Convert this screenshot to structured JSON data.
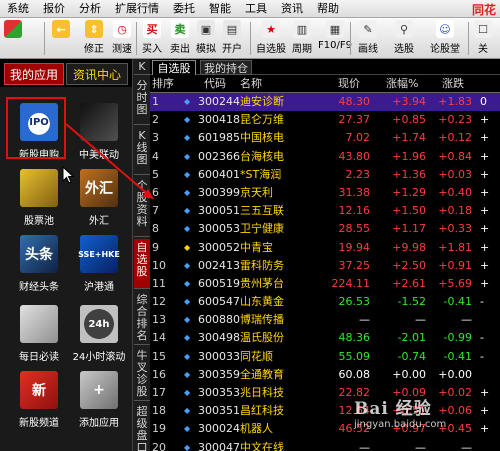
{
  "menubar": {
    "items": [
      "系统",
      "报价",
      "分析",
      "扩展行情",
      "委托",
      "智能",
      "工具",
      "资讯",
      "帮助"
    ],
    "brand": "同花"
  },
  "toolbar": {
    "buttons": [
      {
        "label": "",
        "icon": "color-grid-icon"
      },
      {
        "label": "",
        "icon": "back-arrow-icon"
      },
      {
        "label": "修正",
        "icon": "up-down-arrow-icon"
      },
      {
        "label": "测速",
        "icon": "clock-icon"
      },
      {
        "label": "买入",
        "icon": "buy-icon",
        "glyph": "买"
      },
      {
        "label": "卖出",
        "icon": "sell-icon",
        "glyph": "卖"
      },
      {
        "label": "模拟",
        "icon": "simulate-icon"
      },
      {
        "label": "开户",
        "icon": "open-account-icon"
      },
      {
        "label": "自选股",
        "icon": "watchlist-icon"
      },
      {
        "label": "周期",
        "icon": "period-icon"
      },
      {
        "label": "F10/F9",
        "icon": "f10-icon"
      },
      {
        "label": "画线",
        "icon": "draw-line-icon"
      },
      {
        "label": "选股",
        "icon": "stock-picker-icon"
      },
      {
        "label": "论股堂",
        "icon": "forum-icon"
      },
      {
        "label": "关",
        "icon": "close-icon"
      }
    ]
  },
  "left_panel": {
    "tabs": [
      "我的应用",
      "资讯中心"
    ],
    "apps": [
      {
        "label": "新股申购",
        "icon": "ipo-gauge-icon",
        "glyph": "IPO"
      },
      {
        "label": "中美联动",
        "icon": "us-china-chart-icon",
        "glyph": ""
      },
      {
        "label": "股票池",
        "icon": "stock-pool-icon",
        "glyph": ""
      },
      {
        "label": "外汇",
        "icon": "forex-icon",
        "glyph": "外汇"
      },
      {
        "label": "财经头条",
        "icon": "news-headline-icon",
        "glyph": "头条"
      },
      {
        "label": "沪港通",
        "icon": "hk-connect-icon",
        "glyph": "SSE+HKE"
      },
      {
        "label": "每日必读",
        "icon": "daily-read-icon",
        "glyph": ""
      },
      {
        "label": "24小时滚动",
        "icon": "clock-24h-icon",
        "glyph": "24h"
      },
      {
        "label": "新股频道",
        "icon": "new-stock-channel-icon",
        "glyph": "新"
      },
      {
        "label": "添加应用",
        "icon": "add-icon",
        "glyph": "+"
      }
    ]
  },
  "vertical_tabs": [
    "分时图",
    "K线图",
    "个股资料",
    "自选股",
    "综合排名",
    "牛叉诊股",
    "超级盘口"
  ],
  "vtab_collapse": "K",
  "main": {
    "tabs": [
      "自选股",
      "我的持仓"
    ],
    "columns": {
      "idx": "排序",
      "code": "代码",
      "name": "名称",
      "price": "现价",
      "pct": "涨幅%",
      "chg": "涨跌"
    },
    "rows": [
      {
        "idx": "1",
        "code": "300244",
        "name": "迪安诊断",
        "price": "48.30",
        "pct": "+3.94",
        "chg": "+1.83",
        "extra": "0",
        "dir": "up",
        "sel": true
      },
      {
        "idx": "2",
        "code": "300418",
        "name": "昆仑万维",
        "price": "27.37",
        "pct": "+0.85",
        "chg": "+0.23",
        "extra": "+",
        "dir": "up"
      },
      {
        "idx": "3",
        "code": "601985",
        "name": "中国核电",
        "price": "7.02",
        "pct": "+1.74",
        "chg": "+0.12",
        "extra": "+",
        "dir": "up"
      },
      {
        "idx": "4",
        "code": "002366",
        "name": "台海核电",
        "price": "43.80",
        "pct": "+1.96",
        "chg": "+0.84",
        "extra": "+",
        "dir": "up"
      },
      {
        "idx": "5",
        "code": "600401",
        "name": "*ST海润",
        "price": "2.23",
        "pct": "+1.36",
        "chg": "+0.03",
        "extra": "+",
        "dir": "up"
      },
      {
        "idx": "6",
        "code": "300399",
        "name": "京天利",
        "price": "31.38",
        "pct": "+1.29",
        "chg": "+0.40",
        "extra": "+",
        "dir": "up"
      },
      {
        "idx": "7",
        "code": "300051",
        "name": "三五互联",
        "price": "12.16",
        "pct": "+1.50",
        "chg": "+0.18",
        "extra": "+",
        "dir": "up"
      },
      {
        "idx": "8",
        "code": "300053",
        "name": "卫宁健康",
        "price": "28.55",
        "pct": "+1.17",
        "chg": "+0.33",
        "extra": "+",
        "dir": "up"
      },
      {
        "idx": "9",
        "code": "300052",
        "name": "中青宝",
        "price": "19.94",
        "pct": "+9.98",
        "chg": "+1.81",
        "extra": "+",
        "dir": "up"
      },
      {
        "idx": "10",
        "code": "002413",
        "name": "雷科防务",
        "price": "37.25",
        "pct": "+2.50",
        "chg": "+0.91",
        "extra": "+",
        "dir": "up"
      },
      {
        "idx": "11",
        "code": "600519",
        "name": "贵州茅台",
        "price": "224.11",
        "pct": "+2.61",
        "chg": "+5.69",
        "extra": "+",
        "dir": "up"
      },
      {
        "idx": "12",
        "code": "600547",
        "name": "山东黄金",
        "price": "26.53",
        "pct": "-1.52",
        "chg": "-0.41",
        "extra": "-",
        "dir": "down"
      },
      {
        "idx": "13",
        "code": "600880",
        "name": "博瑞传播",
        "price": "—",
        "pct": "—",
        "chg": "—",
        "extra": "",
        "dir": "flat"
      },
      {
        "idx": "14",
        "code": "300498",
        "name": "温氏股份",
        "price": "48.36",
        "pct": "-2.01",
        "chg": "-0.99",
        "extra": "-",
        "dir": "down"
      },
      {
        "idx": "15",
        "code": "300033",
        "name": "同花顺",
        "price": "55.09",
        "pct": "-0.74",
        "chg": "-0.41",
        "extra": "-",
        "dir": "down"
      },
      {
        "idx": "16",
        "code": "300359",
        "name": "全通教育",
        "price": "60.08",
        "pct": "+0.00",
        "chg": "+0.00",
        "extra": "",
        "dir": "flat"
      },
      {
        "idx": "17",
        "code": "300353",
        "name": "兆日科技",
        "price": "22.82",
        "pct": "+0.09",
        "chg": "+0.02",
        "extra": "+",
        "dir": "up"
      },
      {
        "idx": "18",
        "code": "300351",
        "name": "昌红科技",
        "price": "12.64",
        "pct": "+0.51",
        "chg": "+0.06",
        "extra": "+",
        "dir": "up"
      },
      {
        "idx": "19",
        "code": "300024",
        "name": "机器人",
        "price": "46.52",
        "pct": "+0.97",
        "chg": "+0.45",
        "extra": "+",
        "dir": "up"
      },
      {
        "idx": "20",
        "code": "300047",
        "name": "中文在线",
        "price": "—",
        "pct": "—",
        "chg": "—",
        "extra": "",
        "dir": "flat"
      }
    ]
  },
  "watermark": {
    "title": "Bai 经验",
    "url": "jingyan.baidu.com"
  },
  "colors": {
    "up": "#ff3c3c",
    "down": "#2ee82e",
    "name": "#ffd700",
    "selected_row": "#3c1a90",
    "accent_red": "#a00000"
  }
}
